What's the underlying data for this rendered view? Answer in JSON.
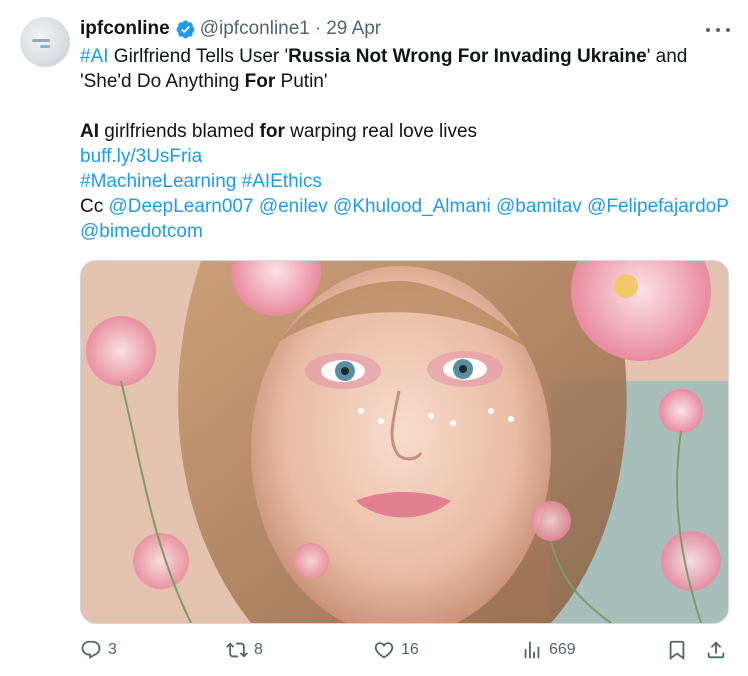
{
  "author": {
    "name": "ipfconline",
    "handle": "@ipfconline1",
    "separator": "·",
    "date": "29 Apr"
  },
  "tweet": {
    "line1": {
      "hashtag": "#AI",
      "t1": " Girlfriend Tells User '",
      "bold1": "Russia Not Wrong For Invading Ukraine",
      "t2": "' and"
    },
    "line2": {
      "t1": "'She'd Do Anything ",
      "bold1": "For",
      "t2": " Putin'"
    },
    "line3": {
      "bold1": "AI",
      "t1": " girlfriends blamed ",
      "bold2": "for",
      "t2": " warping real love lives"
    },
    "link": "buff.ly/3UsFria",
    "hashtags": [
      "#MachineLearning",
      "#AIEthics"
    ],
    "cc_label": "Cc",
    "mentions": [
      "@DeepLearn007",
      "@enilev",
      "@Khulood_Almani",
      "@bamitav",
      "@FelipefajardoP",
      "@bimedotcom"
    ]
  },
  "actions": {
    "replies": "3",
    "reposts": "8",
    "likes": "16",
    "views": "669"
  },
  "icons": {
    "verified": "verified-badge-icon",
    "more": "more-options-icon",
    "reply": "reply-icon",
    "repost": "repost-icon",
    "like": "heart-icon",
    "views": "bar-chart-icon",
    "bookmark": "bookmark-icon",
    "share": "share-icon"
  },
  "colors": {
    "link": "#1d9bf0",
    "text": "#0f1419",
    "muted": "#536471",
    "border": "#cfd9de"
  }
}
